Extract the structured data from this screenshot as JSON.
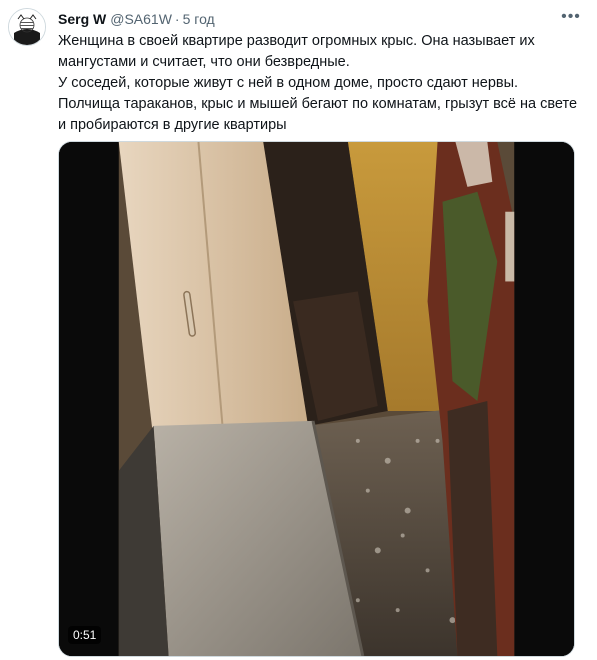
{
  "tweet": {
    "author_name": "Serg W",
    "handle": "@SA61W",
    "separator": "·",
    "time": "5 год",
    "more_icon": "more-horizontal-icon",
    "avatar_icon": "avatar-emblem-icon",
    "text_lines": [
      "Женщина в своей квартире разводит огромных крыс. Она называет их мангустами и считает, что они безвредные.",
      "У соседей, которые живут с ней в одном доме, просто сдают нервы.",
      "Полчища тараканов, крыс и мышей бегают по комнатам, грызут всё на свете и пробираются в другие квартиры"
    ]
  },
  "media": {
    "type": "video",
    "duration": "0:51",
    "scene": "cluttered-apartment-hallway"
  },
  "colors": {
    "text": "#0f1419",
    "secondary": "#536471",
    "border": "#cfd9de"
  }
}
